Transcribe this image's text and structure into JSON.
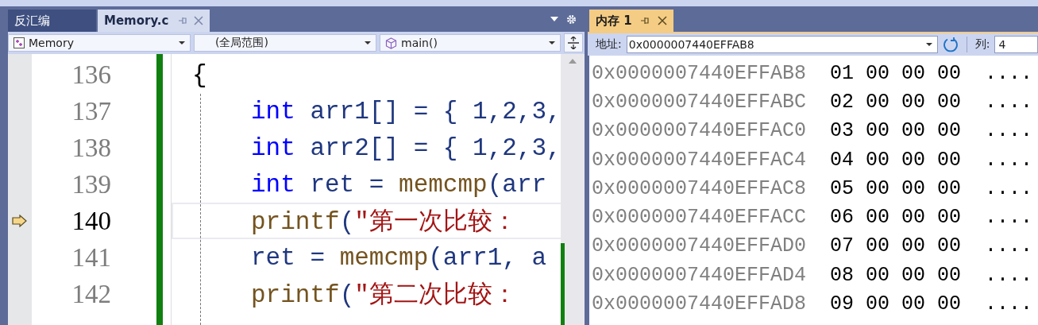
{
  "editor": {
    "tabs": [
      {
        "label": "反汇编",
        "selected": false
      },
      {
        "label": "Memory.c",
        "selected": true
      }
    ],
    "nav": [
      "Memory",
      "(全局范围)",
      "main()"
    ],
    "lines": [
      {
        "number": "136",
        "current": false,
        "tokens": [
          {
            "t": "{",
            "kind": "punct"
          }
        ]
      },
      {
        "number": "137",
        "current": false,
        "tokens": [
          {
            "t": "int",
            "kind": "kw"
          },
          {
            "t": " arr1[] = { 1,2,3,",
            "kind": "plain"
          }
        ]
      },
      {
        "number": "138",
        "current": false,
        "tokens": [
          {
            "t": "int",
            "kind": "kw"
          },
          {
            "t": " arr2[] = { 1,2,3,",
            "kind": "plain"
          }
        ]
      },
      {
        "number": "139",
        "current": false,
        "tokens": [
          {
            "t": "int",
            "kind": "kw"
          },
          {
            "t": " ret = ",
            "kind": "plain"
          },
          {
            "t": "memcmp",
            "kind": "fn"
          },
          {
            "t": "(arr",
            "kind": "plain"
          }
        ]
      },
      {
        "number": "140",
        "current": true,
        "tokens": [
          {
            "t": "printf",
            "kind": "fn"
          },
          {
            "t": "(",
            "kind": "plain"
          },
          {
            "t": "\"第一次比较：",
            "kind": "str"
          }
        ]
      },
      {
        "number": "141",
        "current": false,
        "tokens": [
          {
            "t": "ret = ",
            "kind": "plain"
          },
          {
            "t": "memcmp",
            "kind": "fn"
          },
          {
            "t": "(arr1, a",
            "kind": "plain"
          }
        ]
      },
      {
        "number": "142",
        "current": false,
        "tokens": [
          {
            "t": "printf",
            "kind": "fn"
          },
          {
            "t": "(",
            "kind": "plain"
          },
          {
            "t": "\"第二次比较：",
            "kind": "str"
          }
        ]
      }
    ]
  },
  "memory": {
    "tab": {
      "label": "内存 1",
      "selected": true
    },
    "address_label": "地址:",
    "address": "0x0000007440EFFAB8",
    "columns_label": "列:",
    "columns": "4",
    "rows": [
      {
        "address": "0x0000007440EFFAB8",
        "bytes": [
          "01",
          "00",
          "00",
          "00"
        ],
        "ascii": "...."
      },
      {
        "address": "0x0000007440EFFABC",
        "bytes": [
          "02",
          "00",
          "00",
          "00"
        ],
        "ascii": "...."
      },
      {
        "address": "0x0000007440EFFAC0",
        "bytes": [
          "03",
          "00",
          "00",
          "00"
        ],
        "ascii": "...."
      },
      {
        "address": "0x0000007440EFFAC4",
        "bytes": [
          "04",
          "00",
          "00",
          "00"
        ],
        "ascii": "...."
      },
      {
        "address": "0x0000007440EFFAC8",
        "bytes": [
          "05",
          "00",
          "00",
          "00"
        ],
        "ascii": "...."
      },
      {
        "address": "0x0000007440EFFACC",
        "bytes": [
          "06",
          "00",
          "00",
          "00"
        ],
        "ascii": "...."
      },
      {
        "address": "0x0000007440EFFAD0",
        "bytes": [
          "07",
          "00",
          "00",
          "00"
        ],
        "ascii": "...."
      },
      {
        "address": "0x0000007440EFFAD4",
        "bytes": [
          "08",
          "00",
          "00",
          "00"
        ],
        "ascii": "...."
      },
      {
        "address": "0x0000007440EFFAD8",
        "bytes": [
          "09",
          "00",
          "00",
          "00"
        ],
        "ascii": "...."
      }
    ]
  }
}
